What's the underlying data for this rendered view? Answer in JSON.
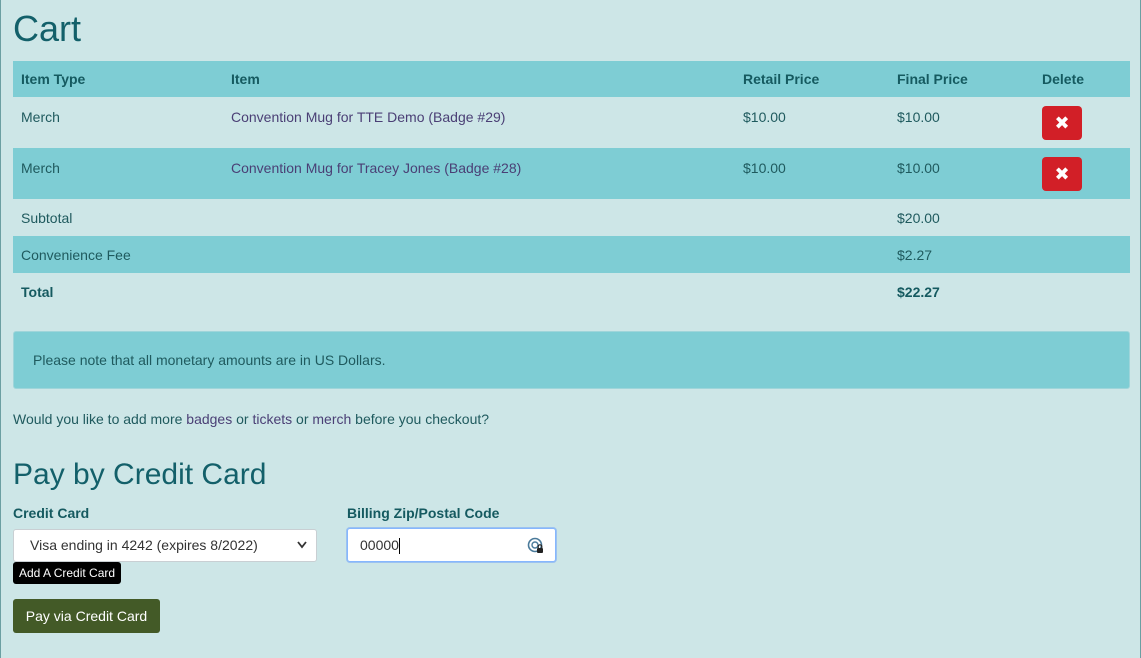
{
  "page": {
    "title": "Cart"
  },
  "cart": {
    "headers": {
      "item_type": "Item Type",
      "item": "Item",
      "retail_price": "Retail Price",
      "final_price": "Final Price",
      "delete": "Delete"
    },
    "items": [
      {
        "type": "Merch",
        "name": "Convention Mug for TTE Demo (Badge #29)",
        "retail": "$10.00",
        "final": "$10.00",
        "delete_icon": "✖"
      },
      {
        "type": "Merch",
        "name": "Convention Mug for Tracey Jones (Badge #28)",
        "retail": "$10.00",
        "final": "$10.00",
        "delete_icon": "✖"
      }
    ],
    "subtotal": {
      "label": "Subtotal",
      "value": "$20.00"
    },
    "fee": {
      "label": "Convenience Fee",
      "value": "$2.27"
    },
    "total": {
      "label": "Total",
      "value": "$22.27"
    }
  },
  "notice": "Please note that all monetary amounts are in US Dollars.",
  "prompt": {
    "before": "Would you like to add more ",
    "badges": "badges",
    "or1": " or ",
    "tickets": "tickets",
    "or2": " or ",
    "merch": "merch",
    "after": " before you checkout?"
  },
  "payment": {
    "title": "Pay by Credit Card",
    "card_label": "Credit Card",
    "card_selected": "Visa ending in 4242 (expires 8/2022)",
    "add_card_tooltip": "Add A Credit Card",
    "zip_label": "Billing Zip/Postal Code",
    "zip_value": "00000",
    "pay_button": "Pay via Credit Card"
  },
  "colors": {
    "background": "#cde6e7",
    "header_bg": "#7ecdd4",
    "delete_red": "#d21f27",
    "pay_green": "#435a27"
  }
}
